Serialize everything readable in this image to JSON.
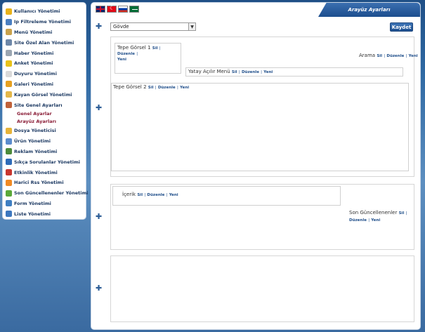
{
  "sidebar": {
    "items": [
      {
        "label": "Kullanıcı Yönetimi",
        "icon": "pencil-icon",
        "color": "#e8b21a"
      },
      {
        "label": "Ip Filtreleme Yönetimi",
        "icon": "filter-icon",
        "color": "#4a7fc1"
      },
      {
        "label": "Menü Yönetimi",
        "icon": "note-icon",
        "color": "#c9a24c"
      },
      {
        "label": "Site Özel Alan Yönetimi",
        "icon": "monitor-icon",
        "color": "#6d87a8"
      },
      {
        "label": "Haber Yönetimi",
        "icon": "tag-icon",
        "color": "#9aa5b1"
      },
      {
        "label": "Anket Yönetimi",
        "icon": "star-icon",
        "color": "#e8c21a"
      },
      {
        "label": "Duyuru Yönetimi",
        "icon": "speech-icon",
        "color": "#d9d9d9"
      },
      {
        "label": "Galeri Yönetimi",
        "icon": "picture-icon",
        "color": "#e6a020"
      },
      {
        "label": "Kayan Görsel Yönetimi",
        "icon": "badge-icon",
        "color": "#e3b74a"
      },
      {
        "label": "Site Genel Ayarları",
        "icon": "home-icon",
        "color": "#c0623a",
        "children": [
          "Genel Ayarlar",
          "Arayüz Ayarları"
        ]
      },
      {
        "label": "Dosya Yöneticisi",
        "icon": "folder-icon",
        "color": "#e7b43a"
      },
      {
        "label": "Ürün Yönetimi",
        "icon": "box-icon",
        "color": "#5b8ccd"
      },
      {
        "label": "Reklam Yönetimi",
        "icon": "ad-icon",
        "color": "#4c8b3a"
      },
      {
        "label": "Sıkça Sorulanlar Yönetimi",
        "icon": "question-icon",
        "color": "#2e6bb8"
      },
      {
        "label": "Etkinlik Yönetimi",
        "icon": "calendar-icon",
        "color": "#c8362e"
      },
      {
        "label": "Harici Rss Yönetimi",
        "icon": "rss-icon",
        "color": "#f08a24"
      },
      {
        "label": "Son Güncellenenler Yönetimi",
        "icon": "flag-icon",
        "color": "#5aa83a"
      },
      {
        "label": "Form Yönetimi",
        "icon": "form-icon",
        "color": "#3f7fc2"
      },
      {
        "label": "Liste Yönetimi",
        "icon": "list-icon",
        "color": "#3d78bf"
      }
    ]
  },
  "header": {
    "title": "Arayüz Ayarları"
  },
  "languages": [
    "English",
    "Türkçe",
    "Русский",
    "العربية"
  ],
  "layout_select": {
    "value": "Gövde"
  },
  "save_label": "Kaydet",
  "links": {
    "delete": "Sil",
    "edit": "Düzenle",
    "new": "Yeni",
    "sep": "|"
  },
  "zones": {
    "tepe_gorsel_1": "Tepe Görsel 1",
    "arama": "Arama",
    "yatay_acilir_menu": "Yatay Açılır Menü",
    "tepe_gorsel_2": "Tepe Görsel 2",
    "icerik": "İçerik",
    "son_guncellenenler": "Son Güncellenenler"
  },
  "colors": {
    "accent": "#1d4f8f",
    "link": "#1f4e8a",
    "submenu": "#8a1c36"
  }
}
